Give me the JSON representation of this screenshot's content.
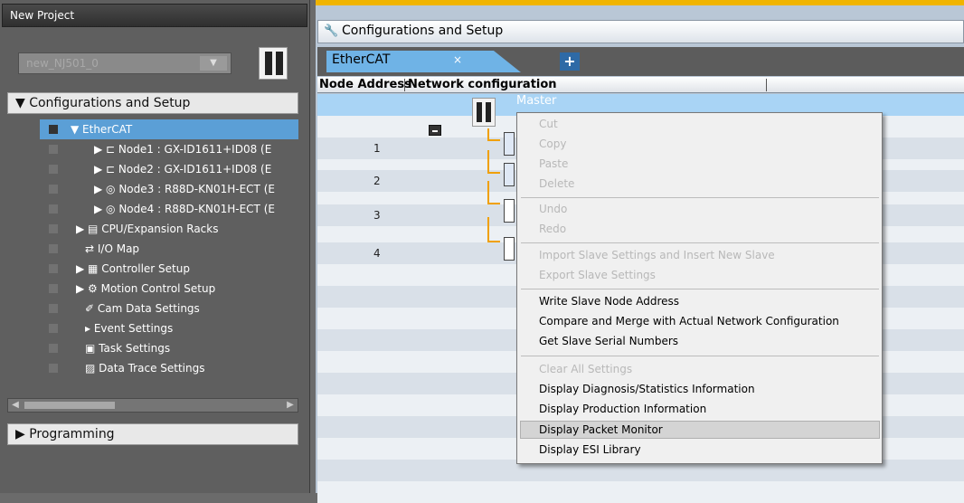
{
  "left": {
    "title": "New Project",
    "project_select": "new_NJ501_0",
    "config_header": "▼ Configurations and Setup",
    "tree": [
      {
        "label": "▼ EtherCAT",
        "indent": 0,
        "selected": true
      },
      {
        "label": "▶ ⊏ Node1 : GX-ID1611+ID08 (E",
        "indent": 2
      },
      {
        "label": "▶ ⊏ Node2 : GX-ID1611+ID08 (E",
        "indent": 2
      },
      {
        "label": "▶ ◎ Node3 : R88D-KN01H-ECT (E",
        "indent": 2
      },
      {
        "label": "▶ ◎ Node4 : R88D-KN01H-ECT (E",
        "indent": 2
      },
      {
        "label": "▶ ▤ CPU/Expansion Racks",
        "indent": 1
      },
      {
        "label": "⇄ I/O Map",
        "indent": 1
      },
      {
        "label": "▶ ▦ Controller Setup",
        "indent": 1
      },
      {
        "label": "▶ ⚙ Motion Control Setup",
        "indent": 1
      },
      {
        "label": "✐ Cam Data Settings",
        "indent": 1
      },
      {
        "label": "▸ Event Settings",
        "indent": 1
      },
      {
        "label": "▣ Task Settings",
        "indent": 1
      },
      {
        "label": "▨ Data Trace Settings",
        "indent": 1
      }
    ],
    "programming_header": "▶ Programming"
  },
  "right": {
    "config_title": "Configurations and Setup",
    "tab_label": "EtherCAT",
    "tab_close": "×",
    "add_tab": "+",
    "col_node_address": "Node Address",
    "col_network_config": "Network configuration",
    "master_label": "Master",
    "nodes": [
      "1",
      "2",
      "3",
      "4"
    ]
  },
  "context_menu": {
    "items": [
      {
        "label": "Cut",
        "enabled": false
      },
      {
        "label": "Copy",
        "enabled": false
      },
      {
        "label": "Paste",
        "enabled": false
      },
      {
        "label": "Delete",
        "enabled": false
      },
      {
        "label": "Undo",
        "enabled": false
      },
      {
        "label": "Redo",
        "enabled": false
      },
      {
        "label": "Import Slave Settings and Insert New Slave",
        "enabled": false
      },
      {
        "label": "Export Slave Settings",
        "enabled": false
      },
      {
        "label": "Write Slave Node Address",
        "enabled": true
      },
      {
        "label": "Compare and Merge with Actual Network Configuration",
        "enabled": true
      },
      {
        "label": "Get Slave Serial Numbers",
        "enabled": true
      },
      {
        "label": "Clear All Settings",
        "enabled": false
      },
      {
        "label": "Display Diagnosis/Statistics Information",
        "enabled": true
      },
      {
        "label": "Display Production Information",
        "enabled": true
      },
      {
        "label": "Display Packet Monitor",
        "enabled": true,
        "highlighted": true
      },
      {
        "label": "Display ESI Library",
        "enabled": true
      }
    ]
  },
  "colors": {
    "accent": "#6fb3e6",
    "selection": "#5b9fd6",
    "wire": "#f0a000",
    "top_bar": "#f0b400"
  }
}
